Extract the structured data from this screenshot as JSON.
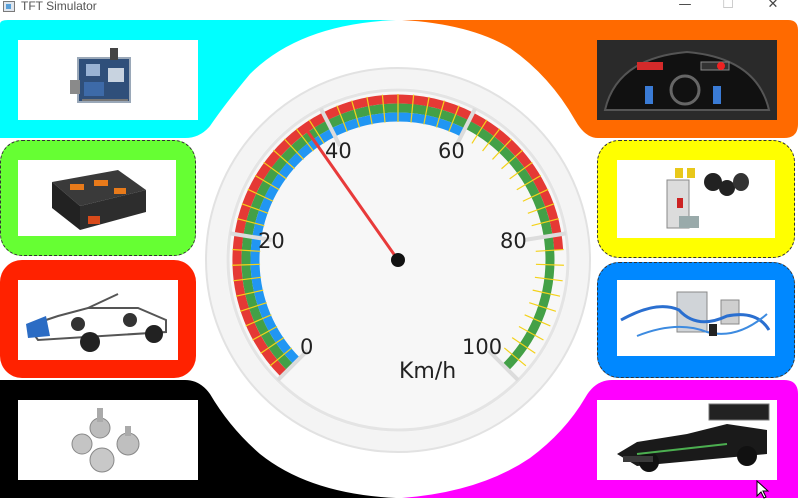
{
  "window": {
    "title": "TFT Simulator",
    "minimize_symbol": "—",
    "maximize_symbol": "☐",
    "close_symbol": "✕"
  },
  "speedometer": {
    "value": 37,
    "min": 0,
    "max": 100,
    "unit": "Km/h",
    "scale_labels": [
      "0",
      "20",
      "40",
      "60",
      "80",
      "100"
    ],
    "needle_color": "#e83a3a",
    "bands": [
      "#e53935",
      "#43a047",
      "#2196f3"
    ],
    "tick_color": "#f4d21a"
  },
  "tiles": [
    {
      "name": "tile-top-left",
      "color": "#00ffff",
      "image": "3D component assembly render"
    },
    {
      "name": "tile-top-right",
      "color": "#ff6a00",
      "image": "cockpit steering wheel render"
    },
    {
      "name": "tile-mid-left-1",
      "color": "#66ff33",
      "image": "battery box render"
    },
    {
      "name": "tile-mid-right-1",
      "color": "#ffff00",
      "image": "pedal box render"
    },
    {
      "name": "tile-mid-left-2",
      "color": "#ff2200",
      "image": "race car chassis render"
    },
    {
      "name": "tile-mid-right-2",
      "color": "#0088ff",
      "image": "wiring harness render"
    },
    {
      "name": "tile-bottom-left",
      "color": "#000000",
      "image": "gear set render"
    },
    {
      "name": "tile-bottom-right",
      "color": "#ff00ff",
      "image": "finished race car render"
    }
  ]
}
